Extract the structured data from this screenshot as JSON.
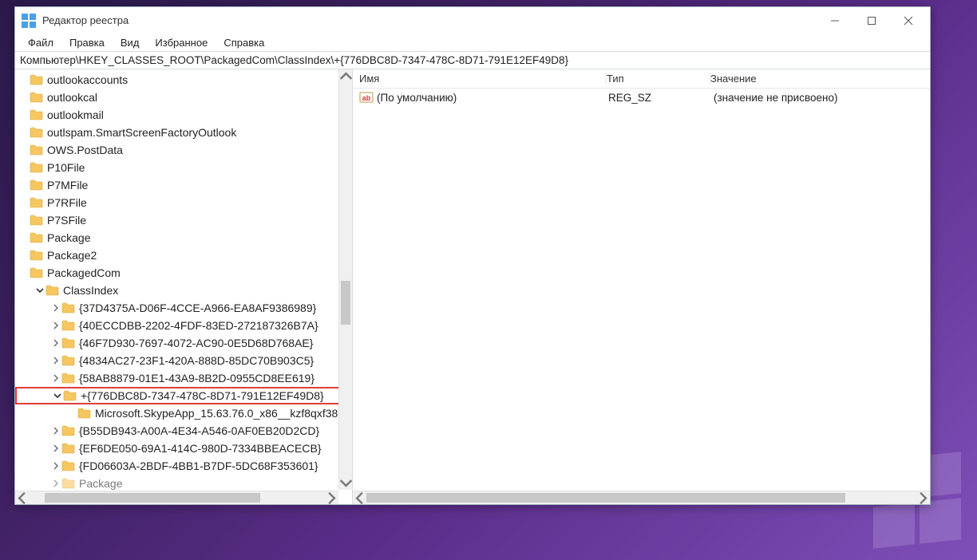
{
  "window": {
    "title": "Редактор реестра"
  },
  "menubar": {
    "file": "Файл",
    "edit": "Правка",
    "view": "Вид",
    "favorites": "Избранное",
    "help": "Справка"
  },
  "address": "Компьютер\\HKEY_CLASSES_ROOT\\PackagedCom\\ClassIndex\\+{776DBC8D-7347-478C-8D71-791E12EF49D8}",
  "tree": {
    "items": [
      {
        "indent": 1,
        "chev": "none",
        "label": "outlookaccounts"
      },
      {
        "indent": 1,
        "chev": "none",
        "label": "outlookcal"
      },
      {
        "indent": 1,
        "chev": "none",
        "label": "outlookmail"
      },
      {
        "indent": 1,
        "chev": "none",
        "label": "outlspam.SmartScreenFactoryOutlook"
      },
      {
        "indent": 1,
        "chev": "none",
        "label": "OWS.PostData"
      },
      {
        "indent": 1,
        "chev": "none",
        "label": "P10File"
      },
      {
        "indent": 1,
        "chev": "none",
        "label": "P7MFile"
      },
      {
        "indent": 1,
        "chev": "none",
        "label": "P7RFile"
      },
      {
        "indent": 1,
        "chev": "none",
        "label": "P7SFile"
      },
      {
        "indent": 1,
        "chev": "none",
        "label": "Package"
      },
      {
        "indent": 1,
        "chev": "none",
        "label": "Package2"
      },
      {
        "indent": 1,
        "chev": "none",
        "label": "PackagedCom"
      },
      {
        "indent": 2,
        "chev": "open",
        "label": "ClassIndex"
      },
      {
        "indent": 3,
        "chev": "closed",
        "label": "{37D4375A-D06F-4CCE-A966-EA8AF9386989}"
      },
      {
        "indent": 3,
        "chev": "closed",
        "label": "{40ECCDBB-2202-4FDF-83ED-272187326B7A}"
      },
      {
        "indent": 3,
        "chev": "closed",
        "label": "{46F7D930-7697-4072-AC90-0E5D68D768AE}"
      },
      {
        "indent": 3,
        "chev": "closed",
        "label": "{4834AC27-23F1-420A-888D-85DC70B903C5}"
      },
      {
        "indent": 3,
        "chev": "closed",
        "label": "{58AB8879-01E1-43A9-8B2D-0955CD8EE619}"
      },
      {
        "indent": 3,
        "chev": "open",
        "label": "+{776DBC8D-7347-478C-8D71-791E12EF49D8}",
        "highlight": true
      },
      {
        "indent": 4,
        "chev": "none",
        "label": "Microsoft.SkypeApp_15.63.76.0_x86__kzf8qxf38"
      },
      {
        "indent": 3,
        "chev": "closed",
        "label": "{B55DB943-A00A-4E34-A546-0AF0EB20D2CD}"
      },
      {
        "indent": 3,
        "chev": "closed",
        "label": "{EF6DE050-69A1-414C-980D-7334BBEACECB}"
      },
      {
        "indent": 3,
        "chev": "closed",
        "label": "{FD06603A-2BDF-4BB1-B7DF-5DC68F353601}"
      },
      {
        "indent": 3,
        "chev": "closed",
        "label": "Package",
        "cutoff": true
      }
    ]
  },
  "values": {
    "header": {
      "name": "Имя",
      "type": "Тип",
      "data": "Значение"
    },
    "rows": [
      {
        "name": "(По умолчанию)",
        "type": "REG_SZ",
        "data": "(значение не присвоено)"
      }
    ]
  }
}
